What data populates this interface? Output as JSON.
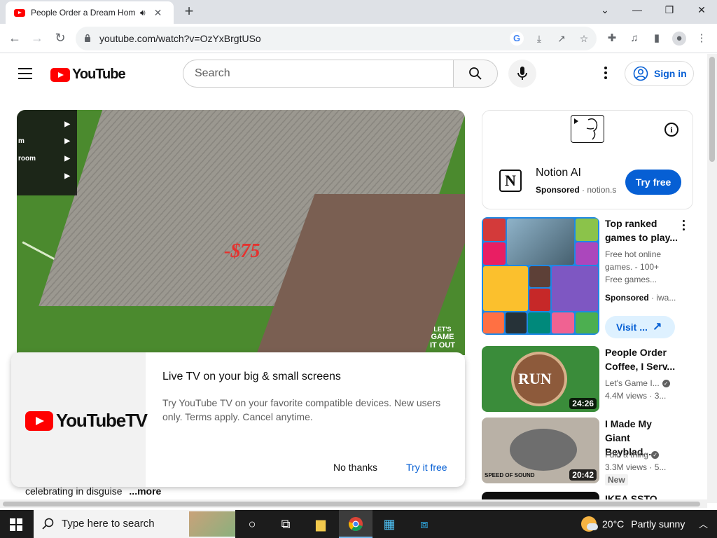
{
  "browser": {
    "tab_title": "People Order a Dream Hom",
    "audio_icon": "speaker-icon",
    "new_tab": "+",
    "window_controls": {
      "chevron": "⌄",
      "minimize": "—",
      "restore": "❐",
      "close": "✕"
    },
    "url": "youtube.com/watch?v=OzYxBrgtUSo"
  },
  "youtube": {
    "logo_text": "YouTube",
    "search_placeholder": "Search",
    "sign_in": "Sign in"
  },
  "player": {
    "menu_items": [
      "",
      "m",
      "room",
      ""
    ],
    "price_popup": "-$75",
    "watermark": [
      "LET'S",
      "GAME",
      "IT OUT"
    ]
  },
  "promo": {
    "logo_text": "YouTubeTV",
    "title": "Live TV on your big & small screens",
    "body": "Try YouTube TV on your favorite compatible devices. New users only. Terms apply. Cancel anytime.",
    "no_thanks": "No thanks",
    "try_free": "Try it free"
  },
  "description": {
    "text": "celebrating in disguise",
    "more": "...more"
  },
  "sidebar": {
    "ad": {
      "name": "Notion AI",
      "sponsored": "Sponsored",
      "domain": "notion.s",
      "cta": "Try free"
    },
    "games_ad": {
      "title": "Top ranked games to play...",
      "desc": "Free hot online games. - 100+ Free games...",
      "sponsored": "Sponsored",
      "source": "iwa...",
      "cta": "Visit ..."
    },
    "videos": [
      {
        "title": "People Order Coffee, I Serv...",
        "channel": "Let's Game I...",
        "views": "4.4M views",
        "age": "3...",
        "duration": "24:26",
        "thumb_text": "RUN"
      },
      {
        "title": "I Made My Giant Beyblad...",
        "channel": "I did a thing",
        "views": "3.3M views",
        "age": "5...",
        "duration": "20:42",
        "thumb_text": "SPEED OF SOUND",
        "badge": "New"
      },
      {
        "title": "IKEA SSTO"
      }
    ]
  },
  "taskbar": {
    "search_placeholder": "Type here to search",
    "temperature": "20°C",
    "weather": "Partly sunny"
  },
  "colors": {
    "youtube_red": "#ff0000",
    "link_blue": "#065fd4",
    "chrome_tabstrip": "#dee1e6",
    "taskbar": "#1c1c1c"
  }
}
